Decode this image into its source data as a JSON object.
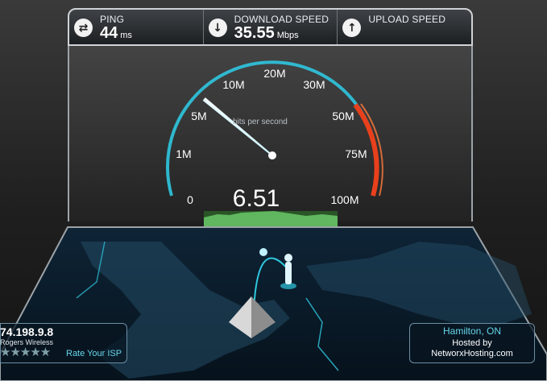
{
  "stats": {
    "ping": {
      "label": "PING",
      "value": "44",
      "unit": "ms",
      "icon": "ping-icon"
    },
    "download": {
      "label": "DOWNLOAD SPEED",
      "value": "35.55",
      "unit": "Mbps",
      "icon": "download-arrow-icon"
    },
    "upload": {
      "label": "UPLOAD SPEED",
      "value": "",
      "unit": "",
      "icon": "upload-arrow-icon"
    }
  },
  "gauge": {
    "ticks": [
      "0",
      "1M",
      "5M",
      "10M",
      "20M",
      "30M",
      "50M",
      "75M",
      "100M"
    ],
    "unit_label": "bits per second",
    "current_value": "6.51",
    "needle_position": 0.29
  },
  "server": {
    "ip": "74.198.9.8",
    "isp": "Rogers Wireless",
    "rating_stars": "★★★★★",
    "rating_value": 0,
    "rate_label": "Rate Your ISP",
    "city": "Hamilton, ON",
    "hosted_by_label": "Hosted by",
    "host": "NetworxHosting.com"
  },
  "colors": {
    "accent": "#2fc7e0",
    "danger": "#e8401c",
    "graph": "#4ab44a"
  }
}
